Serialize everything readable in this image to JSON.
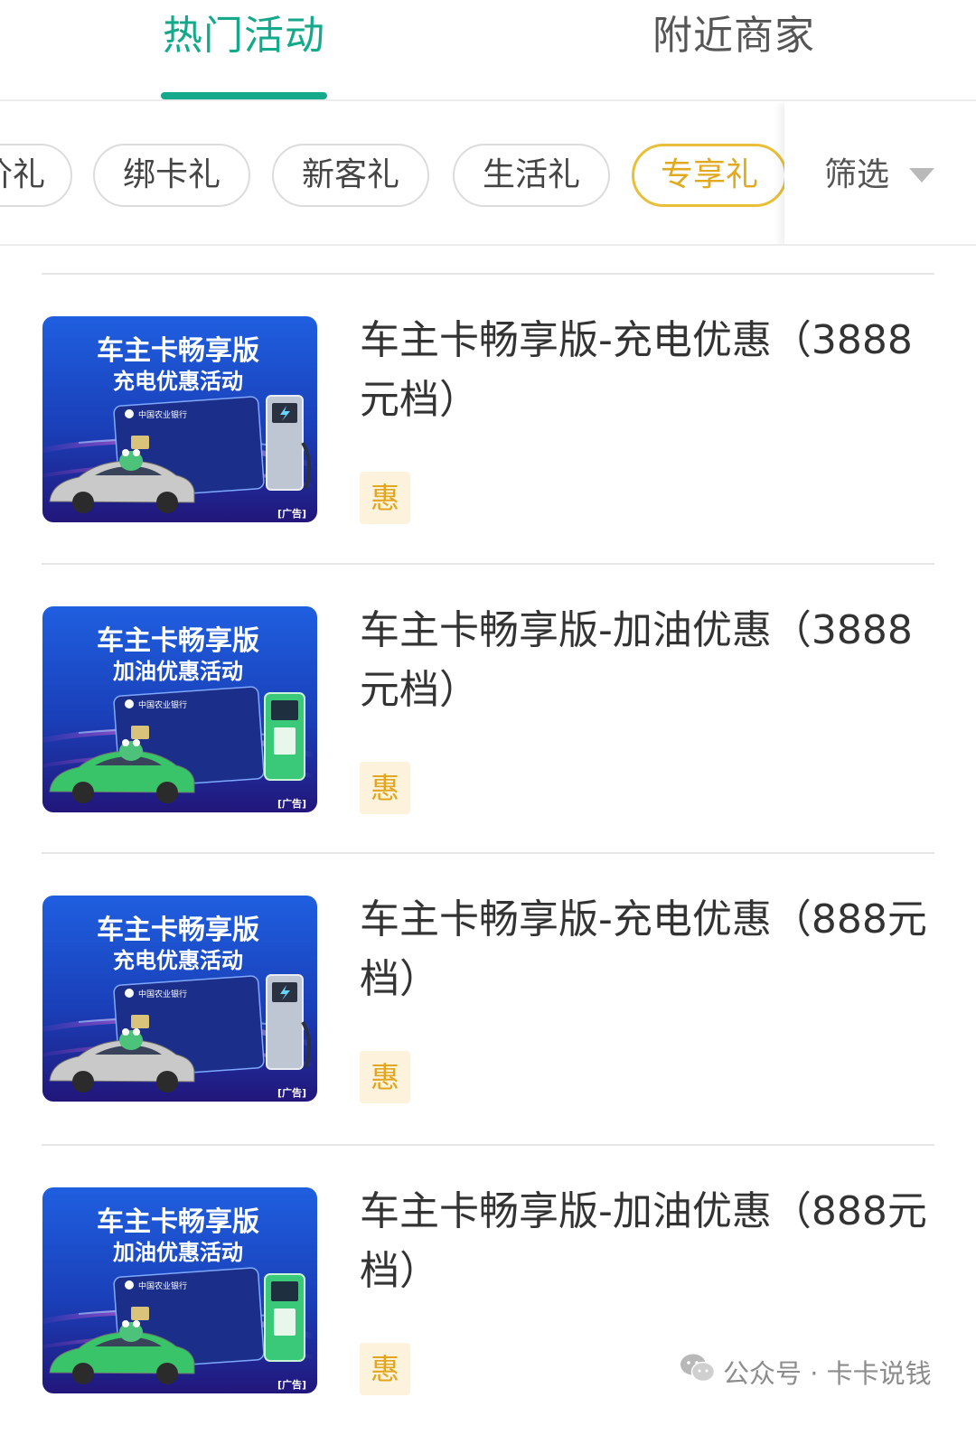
{
  "tabs": [
    {
      "label": "热门活动",
      "active": true
    },
    {
      "label": "附近商家",
      "active": false
    }
  ],
  "chips": [
    {
      "label": "价礼"
    },
    {
      "label": "绑卡礼"
    },
    {
      "label": "新客礼"
    },
    {
      "label": "生活礼"
    },
    {
      "label": "专享礼",
      "active": true
    }
  ],
  "filter": {
    "label": "筛选",
    "icon": "triangle-down-icon"
  },
  "items": [
    {
      "title": "车主卡畅享版-充电优惠（3888元档）",
      "badge": "惠",
      "image": {
        "headline": "车主卡畅享版",
        "subline": "充电优惠活动",
        "ad": "[广告]",
        "bank": "中国农业银行",
        "variant": "charging",
        "car_color": "#c9c9c9"
      }
    },
    {
      "title": "车主卡畅享版-加油优惠（3888元档）",
      "badge": "惠",
      "image": {
        "headline": "车主卡畅享版",
        "subline": "加油优惠活动",
        "ad": "[广告]",
        "bank": "中国农业银行",
        "variant": "fuel",
        "car_color": "#39c46a"
      }
    },
    {
      "title": "车主卡畅享版-充电优惠（888元档）",
      "badge": "惠",
      "image": {
        "headline": "车主卡畅享版",
        "subline": "充电优惠活动",
        "ad": "[广告]",
        "bank": "中国农业银行",
        "variant": "charging",
        "car_color": "#c9c9c9"
      }
    },
    {
      "title": "车主卡畅享版-加油优惠（888元档）",
      "badge": "惠",
      "image": {
        "headline": "车主卡畅享版",
        "subline": "加油优惠活动",
        "ad": "[广告]",
        "bank": "中国农业银行",
        "variant": "fuel",
        "car_color": "#39c46a"
      }
    }
  ],
  "watermark": {
    "text": "公众号 · 卡卡说钱",
    "icon": "wechat-icon"
  },
  "colors": {
    "accent": "#13a98a",
    "chip_active": "#e0a920",
    "badge_bg": "#fdf2dc",
    "badge_text": "#e2a51e"
  }
}
